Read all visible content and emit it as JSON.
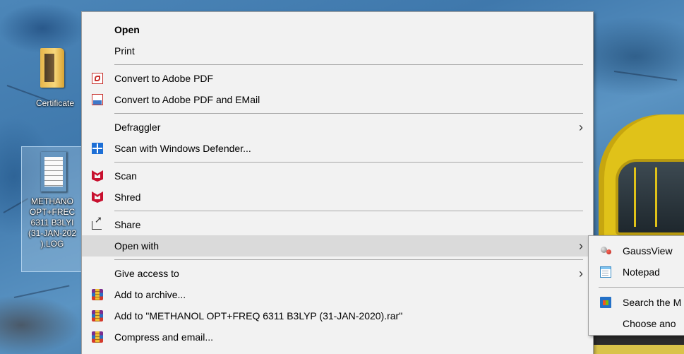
{
  "desktop": {
    "icons": [
      {
        "label": "Certificate"
      },
      {
        "label": "METHANO\nOPT+FREC\n6311 B3LYI\n(31-JAN-202\n).LOG"
      }
    ]
  },
  "context_menu": {
    "items": [
      {
        "label": "Open"
      },
      {
        "label": "Print"
      },
      {
        "label": "Convert to Adobe PDF",
        "icon": "adobe-pdf-icon"
      },
      {
        "label": "Convert to Adobe PDF and EMail",
        "icon": "adobe-pdf-email-icon"
      },
      {
        "label": "Defraggler"
      },
      {
        "label": "Scan with Windows Defender...",
        "icon": "windows-defender-icon"
      },
      {
        "label": "Scan",
        "icon": "mcafee-icon"
      },
      {
        "label": "Shred",
        "icon": "mcafee-icon"
      },
      {
        "label": "Share",
        "icon": "share-icon"
      },
      {
        "label": "Open with"
      },
      {
        "label": "Give access to"
      },
      {
        "label": "Add to archive...",
        "icon": "winrar-icon"
      },
      {
        "label": "Add to \"METHANOL OPT+FREQ 6311 B3LYP (31-JAN-2020).rar\"",
        "icon": "winrar-icon"
      },
      {
        "label": "Compress and email...",
        "icon": "winrar-icon"
      }
    ],
    "chevron": "›"
  },
  "submenu": {
    "items": [
      {
        "label": "GaussView",
        "icon": "gaussview-icon"
      },
      {
        "label": "Notepad",
        "icon": "notepad-icon"
      },
      {
        "label": "Search the M",
        "icon": "microsoft-store-icon"
      },
      {
        "label": "Choose ano"
      }
    ]
  },
  "colors": {
    "menu_background": "#f2f2f2",
    "menu_hover": "#dadada",
    "separator": "#a8a8a8"
  }
}
